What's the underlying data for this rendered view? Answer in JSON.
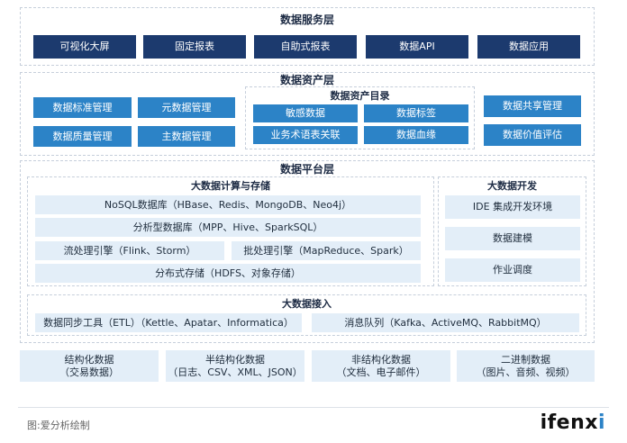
{
  "service_layer": {
    "title": "数据服务层",
    "items": [
      "可视化大屏",
      "固定报表",
      "自助式报表",
      "数据API",
      "数据应用"
    ]
  },
  "asset_layer": {
    "title": "数据资产层",
    "left": [
      "数据标准管理",
      "元数据管理",
      "数据质量管理",
      "主数据管理"
    ],
    "catalog": {
      "title": "数据资产目录",
      "items": [
        "敏感数据",
        "数据标签",
        "业务术语表关联",
        "数据血缘"
      ]
    },
    "right": [
      "数据共享管理",
      "数据价值评估"
    ]
  },
  "platform_layer": {
    "title": "数据平台层",
    "compute": {
      "title": "大数据计算与存储",
      "nosql": "NoSQL数据库（HBase、Redis、MongoDB、Neo4j）",
      "olap": "分析型数据库（MPP、Hive、SparkSQL）",
      "stream": "流处理引擎（Flink、Storm）",
      "batch": "批处理引擎（MapReduce、Spark）",
      "storage": "分布式存储（HDFS、对象存储）"
    },
    "dev": {
      "title": "大数据开发",
      "items": [
        "IDE 集成开发环境",
        "数据建模",
        "作业调度"
      ]
    },
    "ingest": {
      "title": "大数据接入",
      "sync": "数据同步工具（ETL）（Kettle、Apatar、Informatica）",
      "mq": "消息队列（Kafka、ActiveMQ、RabbitMQ）"
    }
  },
  "sources": [
    {
      "name": "结构化数据",
      "detail": "（交易数据）"
    },
    {
      "name": "半结构化数据",
      "detail": "（日志、CSV、XML、JSON）"
    },
    {
      "name": "非结构化数据",
      "detail": "（文档、电子邮件）"
    },
    {
      "name": "二进制数据",
      "detail": "（图片、音频、视频）"
    }
  ],
  "footer": {
    "caption": "图:爱分析绘制",
    "logo_main": "ifenx",
    "logo_end": "i"
  },
  "colors": {
    "navy": "#1c3a6e",
    "blue": "#2c83c7",
    "pale": "#e3eef8",
    "border": "#c6cfdb"
  }
}
